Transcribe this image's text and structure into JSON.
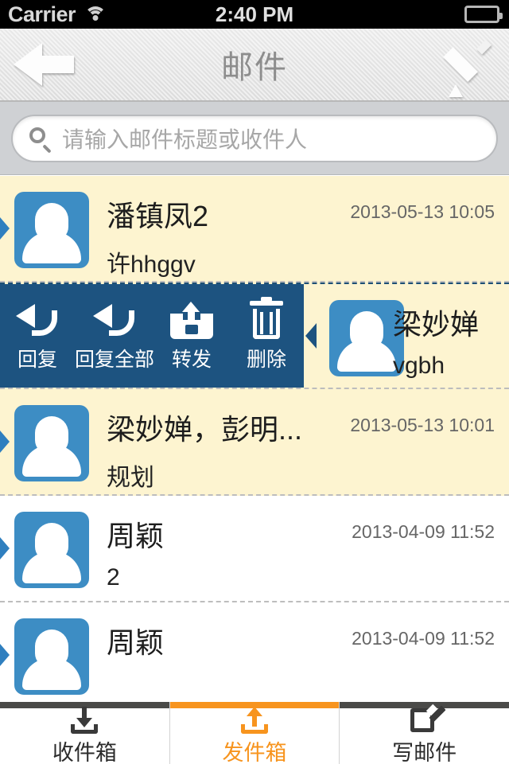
{
  "statusbar": {
    "carrier": "Carrier",
    "time": "2:40 PM",
    "wifi_icon": "wifi-icon",
    "battery_icon": "battery-icon"
  },
  "navbar": {
    "title": "邮件",
    "back_icon": "back-arrow-icon",
    "compose_icon": "pencil-icon"
  },
  "search": {
    "placeholder": "请输入邮件标题或收件人",
    "icon": "search-icon"
  },
  "swipe_actions": [
    {
      "label": "回复",
      "icon": "reply-icon"
    },
    {
      "label": "回复全部",
      "icon": "reply-all-icon"
    },
    {
      "label": "转发",
      "icon": "forward-icon"
    },
    {
      "label": "删除",
      "icon": "trash-icon"
    }
  ],
  "emails": [
    {
      "sender": "潘镇凤2",
      "subject": "许hhggv",
      "time": "2013-05-13 10:05",
      "unread": true,
      "swiped": false
    },
    {
      "sender": "梁妙婵",
      "subject": "vgbh",
      "time": "",
      "unread": true,
      "swiped": true
    },
    {
      "sender": "梁妙婵，彭明...",
      "subject": "规划",
      "time": "2013-05-13 10:01",
      "unread": true,
      "swiped": false
    },
    {
      "sender": "周颖",
      "subject": "2",
      "time": "2013-04-09 11:52",
      "unread": false,
      "swiped": false
    },
    {
      "sender": "周颖",
      "subject": "",
      "time": "2013-04-09 11:52",
      "unread": false,
      "swiped": false
    }
  ],
  "tabs": [
    {
      "label": "收件箱",
      "icon": "inbox-download-icon",
      "active": false
    },
    {
      "label": "发件箱",
      "icon": "outbox-upload-icon",
      "active": true
    },
    {
      "label": "写邮件",
      "icon": "compose-mail-icon",
      "active": false
    }
  ],
  "colors": {
    "accent_orange": "#f7941e",
    "avatar_blue": "#3d8dc4",
    "action_panel_blue": "#1d5380",
    "unread_row": "#fdf4d0",
    "tab_inactive_bar": "#4a4a48"
  }
}
